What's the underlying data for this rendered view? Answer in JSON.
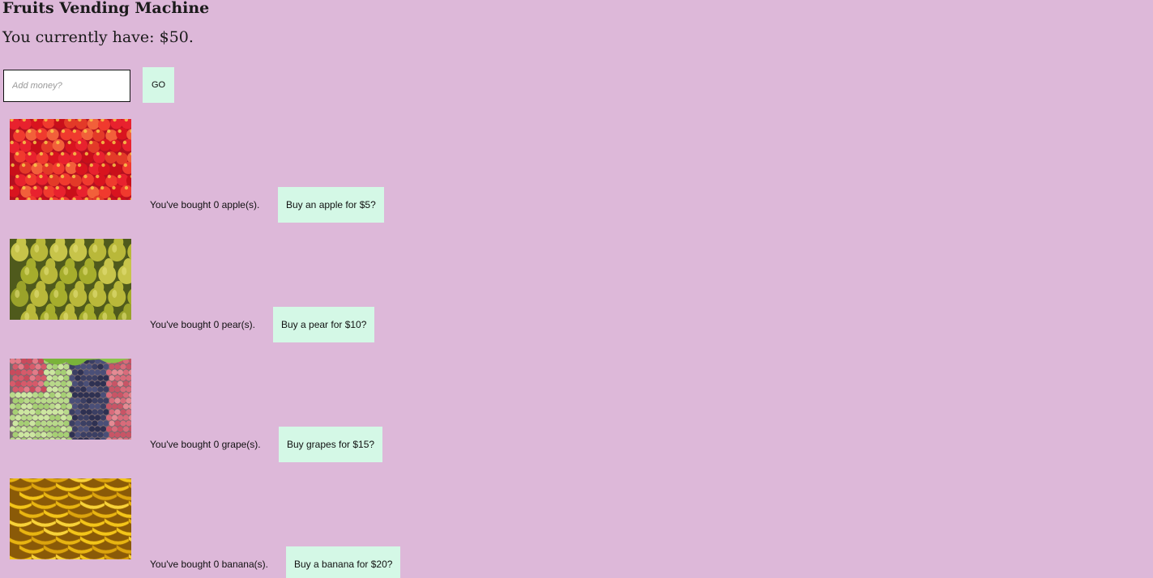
{
  "header": {
    "title": "Fruits Vending Machine",
    "balance_text": "You currently have: $50."
  },
  "add_money": {
    "placeholder": "Add money?",
    "go_label": "GO"
  },
  "fruits": [
    {
      "name": "apple",
      "bought_text": "You've bought 0 apple(s).",
      "buy_label": "Buy an apple for $5?"
    },
    {
      "name": "pear",
      "bought_text": "You've bought 0 pear(s).",
      "buy_label": "Buy a pear for $10?"
    },
    {
      "name": "grape",
      "bought_text": "You've bought 0 grape(s).",
      "buy_label": "Buy grapes for $15?"
    },
    {
      "name": "banana",
      "bought_text": "You've bought 0 banana(s).",
      "buy_label": "Buy a banana for $20?"
    }
  ],
  "colors": {
    "background": "#ddb8d9",
    "button": "#d4f8e6"
  }
}
